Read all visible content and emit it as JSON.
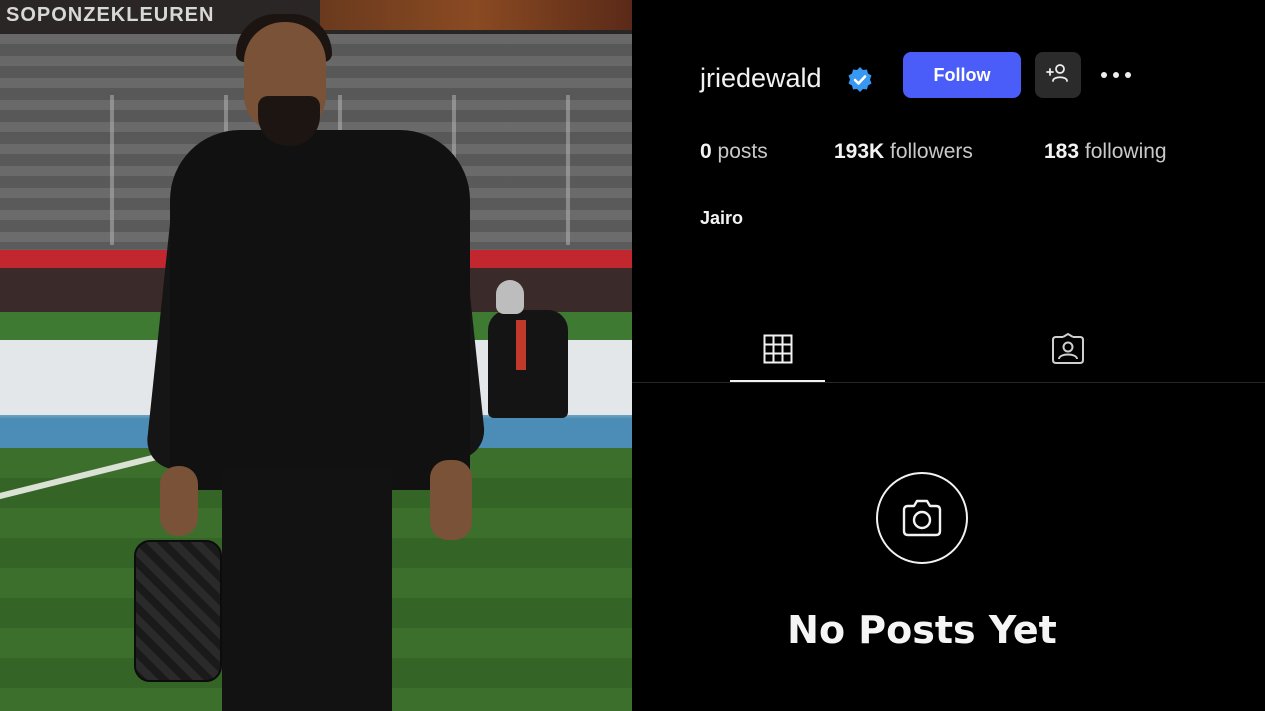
{
  "photo": {
    "banner_text": "SOPONZEKLEUREN"
  },
  "profile": {
    "username": "jriedewald",
    "verified": true,
    "follow_label": "Follow",
    "stats": {
      "posts_count": "0",
      "posts_label": "posts",
      "followers_count": "193K",
      "followers_label": "followers",
      "following_count": "183",
      "following_label": "following"
    },
    "full_name": "Jairo"
  },
  "tabs": [
    {
      "icon": "grid-icon",
      "active": true
    },
    {
      "icon": "tagged-icon",
      "active": false
    }
  ],
  "empty_state": {
    "title": "No Posts Yet",
    "icon": "camera-icon"
  },
  "colors": {
    "follow_button": "#4a5df9",
    "verified_badge": "#3897f0",
    "background": "#000000"
  }
}
